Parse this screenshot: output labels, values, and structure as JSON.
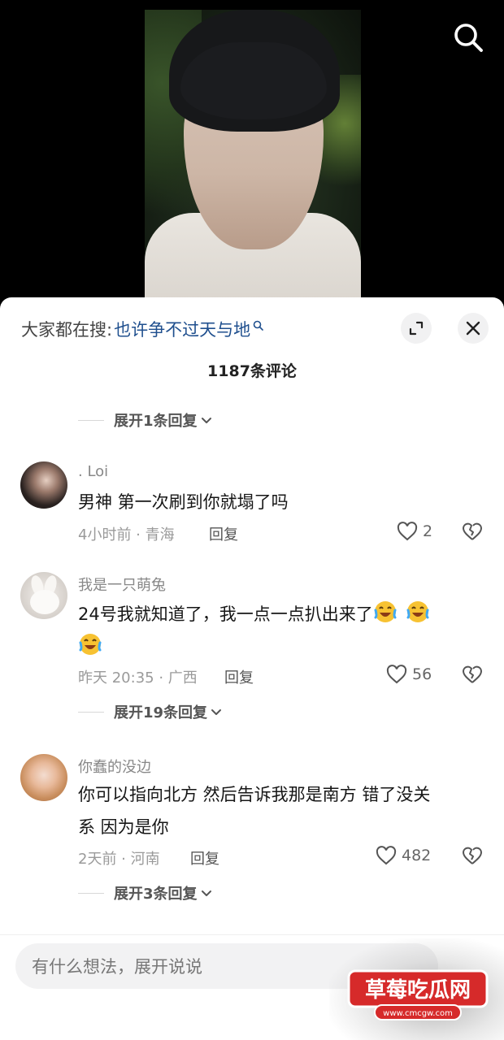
{
  "header": {
    "hot_search_prefix": "大家都在搜:",
    "hot_search_term": "也许争不过天与地",
    "comment_count": "1187条评论"
  },
  "top_expand": {
    "label": "展开1条回复"
  },
  "comments": [
    {
      "username": ". Loi",
      "text": "男神 第一次刷到你就塌了吗",
      "time_location": "4小时前 · 青海",
      "reply_label": "回复",
      "likes": "2"
    },
    {
      "username": "我是一只萌兔",
      "text": "24号我就知道了，我一点一点扒出来了",
      "time_location": "昨天 20:35 · 广西",
      "reply_label": "回复",
      "likes": "56",
      "expand_label": "展开19条回复"
    },
    {
      "username": "你蠢的没边",
      "text_line1": "你可以指向北方 然后告诉我那是南方 错了没关",
      "text_line2": "系 因为是你",
      "time_location": "2天前 · 河南",
      "reply_label": "回复",
      "likes": "482",
      "expand_label": "展开3条回复"
    }
  ],
  "input": {
    "placeholder": "有什么想法，展开说说"
  },
  "watermark": {
    "title": "草莓吃瓜网",
    "url": "www.cmcgw.com"
  },
  "icons": {
    "search": "search-icon",
    "expand": "expand-icon",
    "close": "close-icon",
    "heart": "heart-icon",
    "broken_heart": "broken-heart-icon",
    "chevron": "chevron-down-icon",
    "emoji": "laughing-crying-emoji"
  },
  "colors": {
    "link_blue": "#1f4f8e",
    "watermark_red": "#d62a2a"
  }
}
